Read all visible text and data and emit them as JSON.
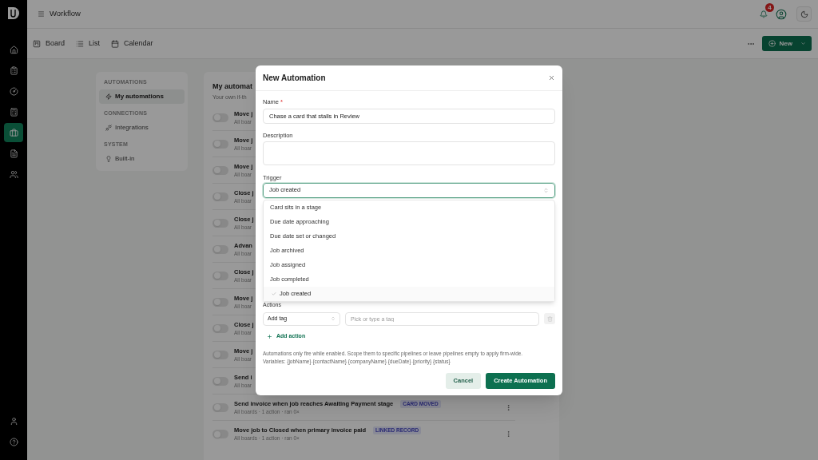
{
  "app": {
    "title": "Workflow",
    "notification_count": "4"
  },
  "rail": {
    "items": [
      {
        "selected": false
      },
      {
        "selected": false
      },
      {
        "selected": false
      },
      {
        "selected": false
      },
      {
        "selected": true
      },
      {
        "selected": false
      },
      {
        "selected": false
      }
    ]
  },
  "views": [
    {
      "label": "Board"
    },
    {
      "label": "List"
    },
    {
      "label": "Calendar"
    }
  ],
  "new_button": {
    "label": "New"
  },
  "settings_nav": {
    "sections": [
      {
        "heading": "AUTOMATIONS",
        "items": [
          {
            "label": "My automations",
            "selected": true
          }
        ]
      },
      {
        "heading": "CONNECTIONS",
        "items": [
          {
            "label": "Integrations",
            "selected": false
          }
        ]
      },
      {
        "heading": "SYSTEM",
        "items": [
          {
            "label": "Built-in",
            "selected": false
          }
        ]
      }
    ]
  },
  "automations": {
    "title": "My automat",
    "subtitle": "Your own if-th",
    "rows": [
      {
        "title": "Move j",
        "meta": "All boar",
        "enabled": false
      },
      {
        "title": "Move j",
        "meta": "All boar",
        "enabled": false
      },
      {
        "title": "Move j",
        "meta": "All boar",
        "enabled": false
      },
      {
        "title": "Close j",
        "meta": "All boar",
        "enabled": false
      },
      {
        "title": "Close j",
        "meta": "All boar",
        "enabled": false
      },
      {
        "title": "Advan",
        "meta": "All boar",
        "enabled": false
      },
      {
        "title": "Close j",
        "meta": "All boar",
        "enabled": false
      },
      {
        "title": "Move j",
        "meta": "All boar",
        "enabled": false
      },
      {
        "title": "Close j",
        "meta": "All boar",
        "enabled": false
      },
      {
        "title": "Move j",
        "meta": "All boar",
        "enabled": false
      },
      {
        "title": "Send i",
        "meta": "All boar",
        "enabled": false
      },
      {
        "title": "Send invoice when job reaches Awaiting Payment stage",
        "badge": "CARD MOVED",
        "meta": "All boards · 1 action · ran 0×",
        "enabled": false
      },
      {
        "title": "Move job to Closed when primary invoice paid",
        "badge": "LINKED RECORD",
        "meta": "All boards · 1 action · ran 0×",
        "enabled": false
      }
    ]
  },
  "dialog": {
    "title": "New Automation",
    "name_field": {
      "label": "Name",
      "required_mark": "*",
      "value": "Chase a card that stalls in Review"
    },
    "description_field": {
      "label": "Description"
    },
    "trigger_field": {
      "label": "Trigger",
      "value": "Job created",
      "expanded": true,
      "options": [
        {
          "label": "Card sits in a stage",
          "selected": false
        },
        {
          "label": "Due date approaching",
          "selected": false
        },
        {
          "label": "Due date set or changed",
          "selected": false
        },
        {
          "label": "Job archived",
          "selected": false
        },
        {
          "label": "Job assigned",
          "selected": false
        },
        {
          "label": "Job completed",
          "selected": false
        },
        {
          "label": "Job created",
          "selected": true
        }
      ]
    },
    "actions": {
      "label": "Actions",
      "rows": [
        {
          "type": "Add tag",
          "placeholder": "Pick or type a tag",
          "remove_disabled": true
        }
      ],
      "add_label": "Add action"
    },
    "note": "Automations only fire while enabled. Scope them to specific pipelines or leave pipelines empty to apply firm-wide.",
    "variables": "Variables: {jobName} {contactName} {companyName} {dueDate} {priority} {status}",
    "buttons": [
      {
        "label": "Cancel",
        "kind": "secondary"
      },
      {
        "label": "Create Automation",
        "kind": "primary"
      }
    ]
  }
}
